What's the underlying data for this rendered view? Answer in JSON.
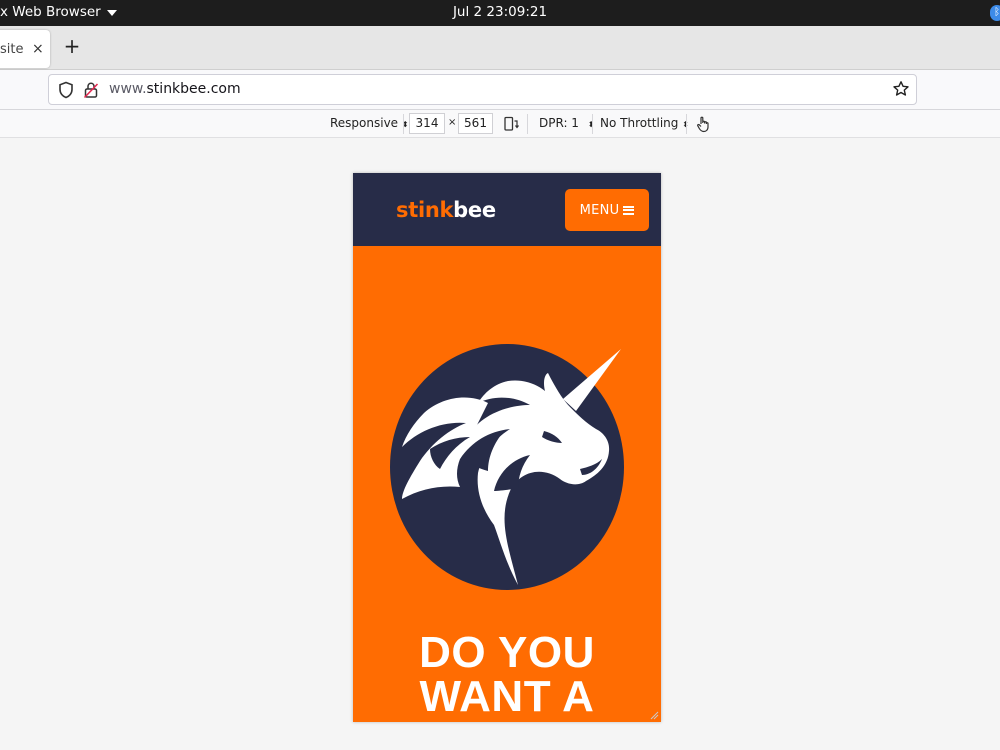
{
  "system_bar": {
    "app_name": "x Web Browser",
    "clock": "Jul 2  23:09:21"
  },
  "browser": {
    "tab": {
      "title": "site",
      "close_glyph": "×"
    },
    "new_tab_glyph": "+",
    "url": {
      "prefix": "www.",
      "domain": "stinkbee.com"
    },
    "icons": {
      "shield": "shield-icon",
      "lock": "lock-icon",
      "star": "bookmark-star-icon"
    }
  },
  "responsive_toolbar": {
    "device": "Responsive",
    "width": "314",
    "times": "×",
    "height": "561",
    "dpr": "DPR: 1",
    "throttling": "No Throttling"
  },
  "site": {
    "logo_part1": "stink",
    "logo_part2": "bee",
    "menu_label": "MENU",
    "headline_line1": "DO YOU",
    "headline_line2": "WANT A",
    "colors": {
      "brand_orange": "#ff6c02",
      "navy": "#272c48",
      "white": "#ffffff"
    }
  }
}
